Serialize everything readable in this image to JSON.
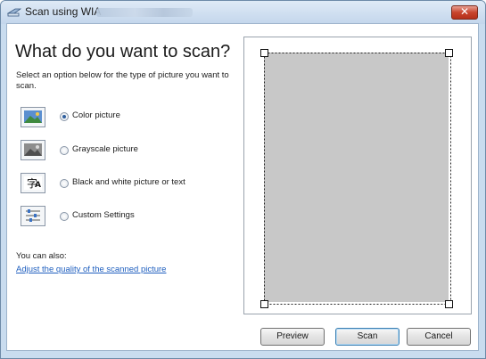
{
  "window": {
    "title": "Scan using WIA",
    "close_symbol": "✕"
  },
  "header": {
    "heading": "What do you want to scan?",
    "instruction": "Select an option below for the type of picture you want to scan."
  },
  "options": [
    {
      "label": "Color picture",
      "checked": true,
      "icon": "color-picture-icon"
    },
    {
      "label": "Grayscale picture",
      "checked": false,
      "icon": "grayscale-picture-icon"
    },
    {
      "label": "Black and white picture or text",
      "checked": false,
      "icon": "bw-picture-text-icon"
    },
    {
      "label": "Custom Settings",
      "checked": false,
      "icon": "custom-settings-icon"
    }
  ],
  "also": {
    "label": "You can also:",
    "link": "Adjust the quality of the scanned picture"
  },
  "buttons": {
    "preview": "Preview",
    "scan": "Scan",
    "cancel": "Cancel"
  },
  "colors": {
    "accent": "#1f5fbf",
    "preview_area": "#c8c8c8"
  }
}
